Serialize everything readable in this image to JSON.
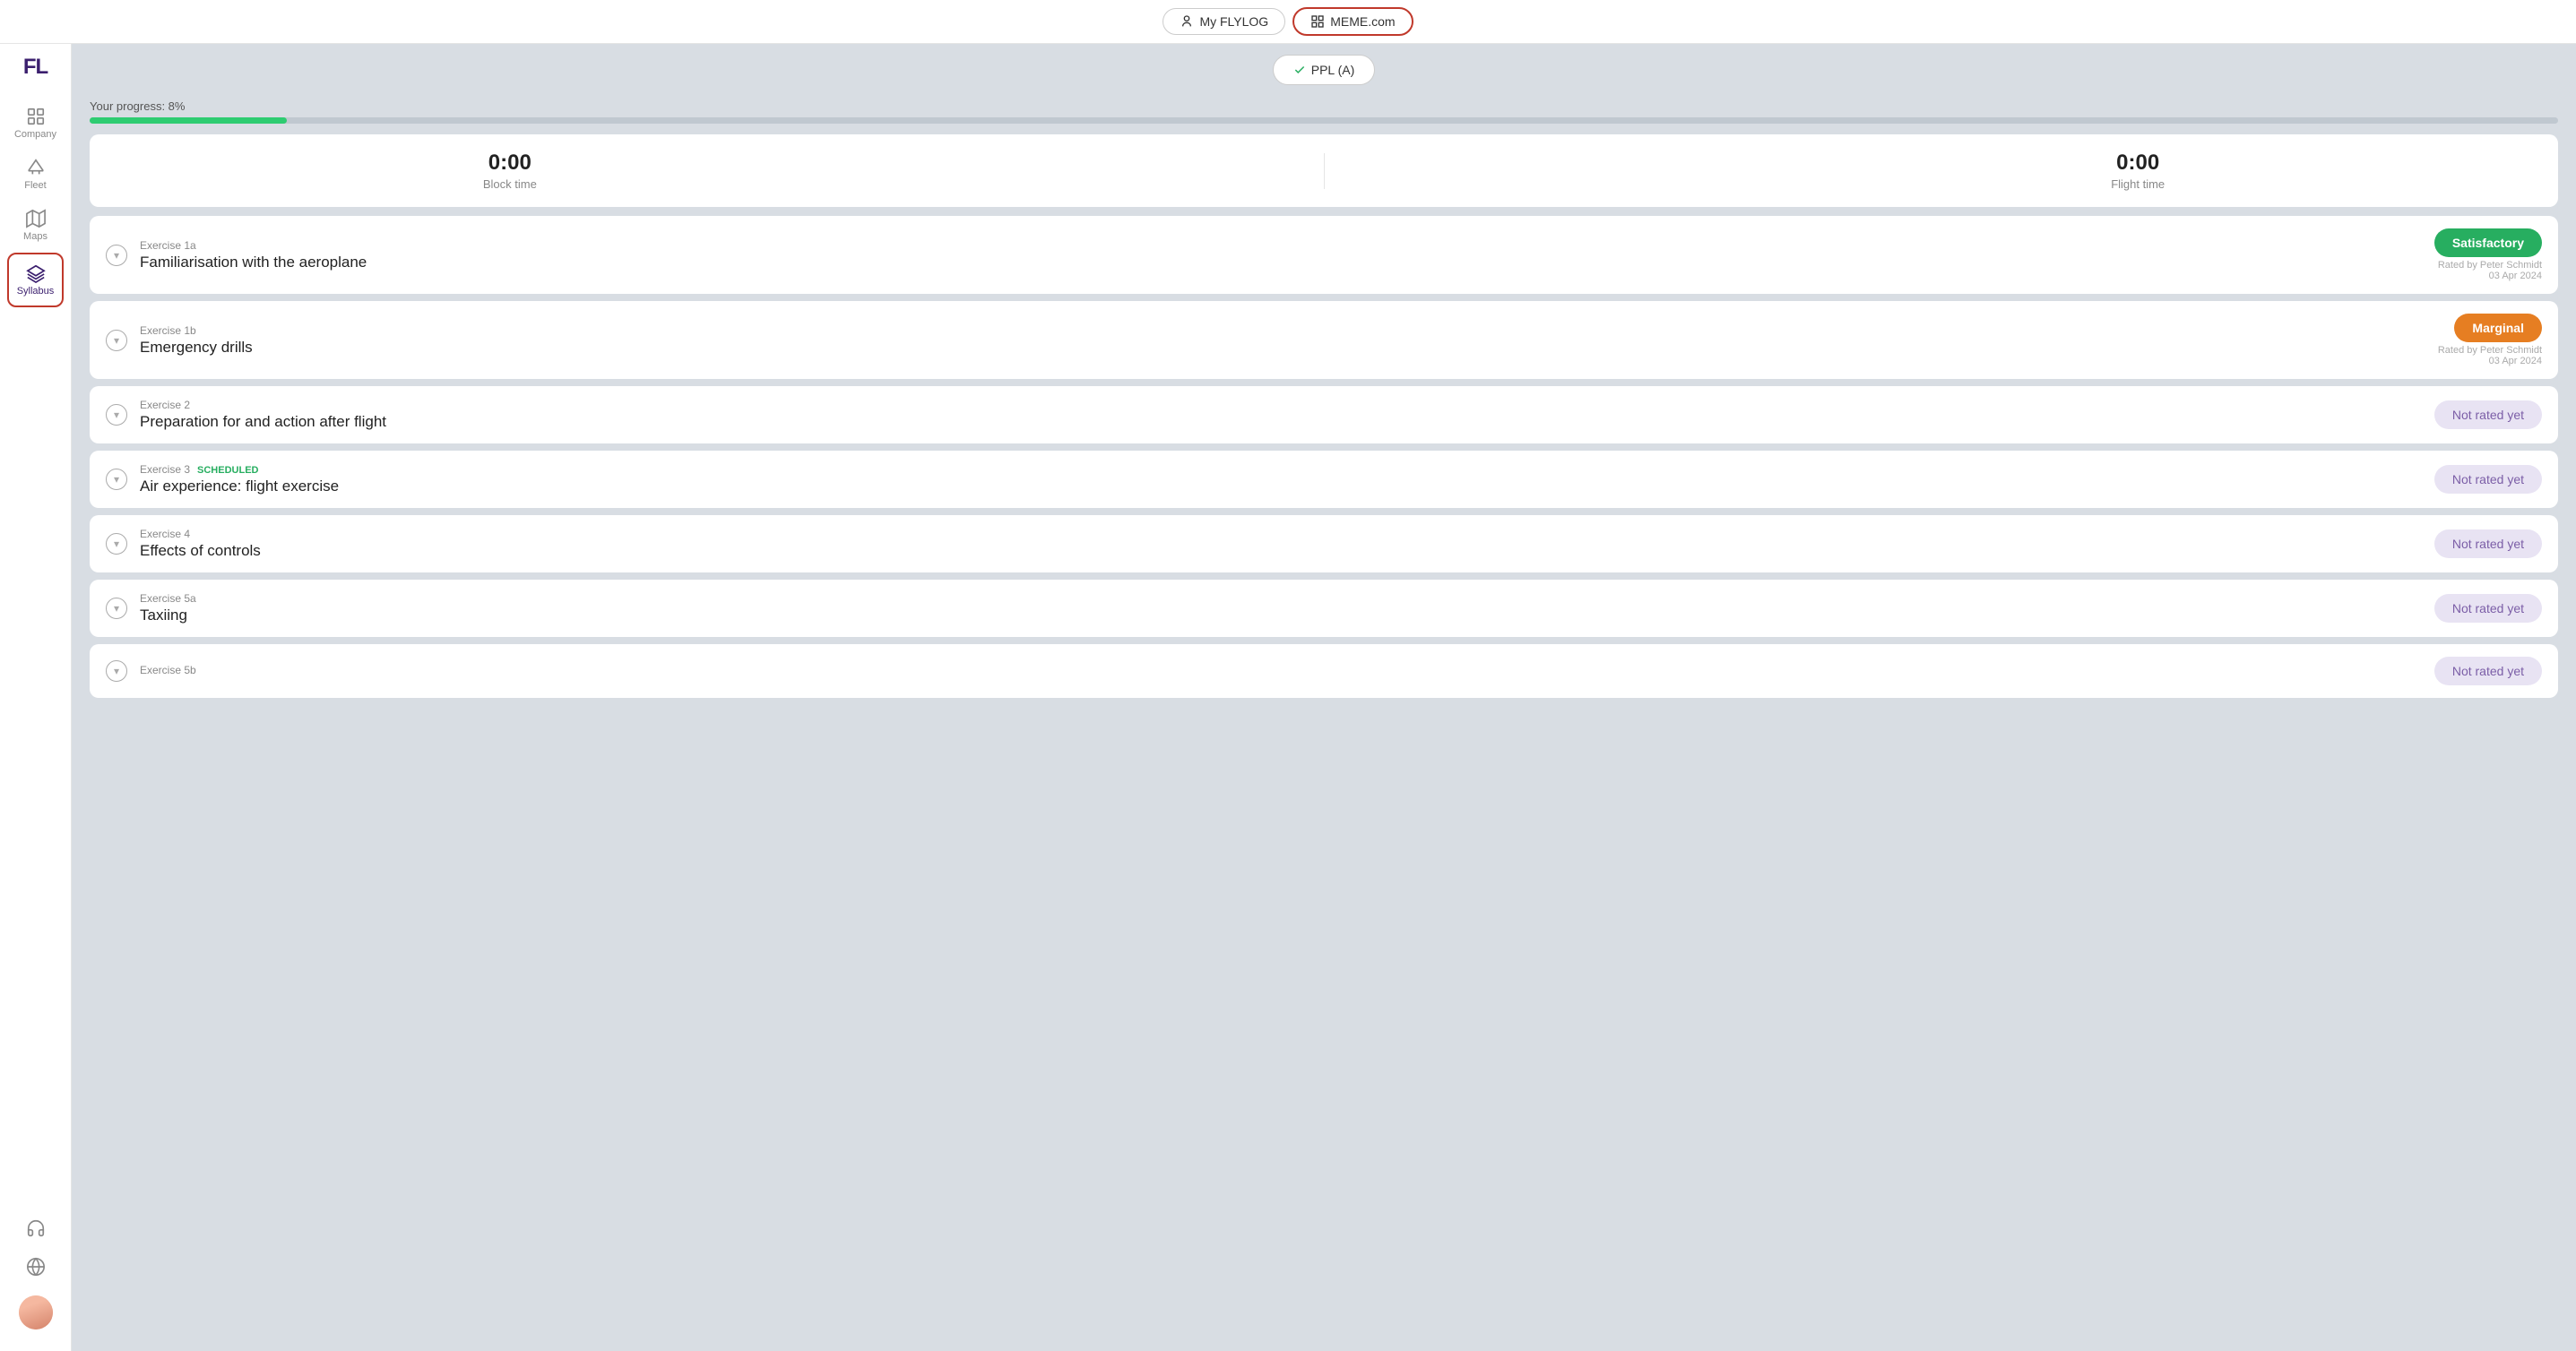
{
  "topNav": {
    "flylog": {
      "label": "My FLYLOG",
      "active": false
    },
    "meme": {
      "label": "MEME.com",
      "active": true
    }
  },
  "sidebar": {
    "logo": "FL",
    "items": [
      {
        "id": "company",
        "label": "Company",
        "icon": "grid"
      },
      {
        "id": "fleet",
        "label": "Fleet",
        "icon": "plane"
      },
      {
        "id": "maps",
        "label": "Maps",
        "icon": "map"
      },
      {
        "id": "syllabus",
        "label": "Syllabus",
        "icon": "book",
        "active": true
      }
    ]
  },
  "header": {
    "badge": "PPL (A)"
  },
  "progress": {
    "label": "Your progress: 8%",
    "percent": 8
  },
  "timeBlock": {
    "blockTime": {
      "value": "0:00",
      "label": "Block time"
    },
    "flightTime": {
      "value": "0:00",
      "label": "Flight time"
    }
  },
  "exercises": [
    {
      "id": "Exercise 1a",
      "title": "Familiarisation with the aeroplane",
      "scheduled": false,
      "rating": "Satisfactory",
      "ratingType": "satisfactory",
      "ratedBy": "Rated by Peter Schmidt",
      "ratedDate": "03 Apr 2024"
    },
    {
      "id": "Exercise 1b",
      "title": "Emergency drills",
      "scheduled": false,
      "rating": "Marginal",
      "ratingType": "marginal",
      "ratedBy": "Rated by Peter Schmidt",
      "ratedDate": "03 Apr 2024"
    },
    {
      "id": "Exercise 2",
      "title": "Preparation for and action after flight",
      "scheduled": false,
      "rating": "Not rated yet",
      "ratingType": "not-rated",
      "ratedBy": "",
      "ratedDate": ""
    },
    {
      "id": "Exercise 3",
      "title": "Air experience: flight exercise",
      "scheduled": true,
      "scheduledLabel": "SCHEDULED",
      "rating": "Not rated yet",
      "ratingType": "not-rated",
      "ratedBy": "",
      "ratedDate": ""
    },
    {
      "id": "Exercise 4",
      "title": "Effects of controls",
      "scheduled": false,
      "rating": "Not rated yet",
      "ratingType": "not-rated",
      "ratedBy": "",
      "ratedDate": ""
    },
    {
      "id": "Exercise 5a",
      "title": "Taxiing",
      "scheduled": false,
      "rating": "Not rated yet",
      "ratingType": "not-rated",
      "ratedBy": "",
      "ratedDate": ""
    },
    {
      "id": "Exercise 5b",
      "title": "",
      "scheduled": false,
      "rating": "Not rated yet",
      "ratingType": "not-rated",
      "ratedBy": "",
      "ratedDate": ""
    }
  ]
}
